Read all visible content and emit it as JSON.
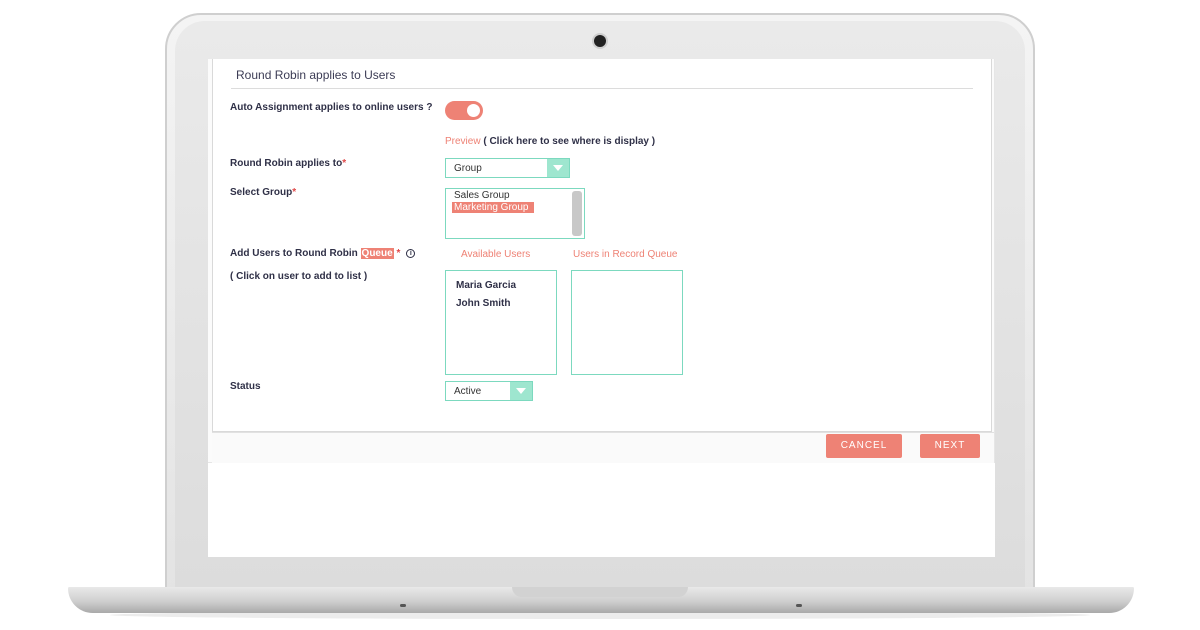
{
  "section": {
    "title": "Round Robin applies to Users"
  },
  "auto_assignment": {
    "label": "Auto Assignment applies to online users ?",
    "enabled": true
  },
  "preview": {
    "link": "Preview",
    "hint": " ( Click here to see where is display )"
  },
  "applies_to": {
    "label": "Round Robin applies to",
    "required": "*",
    "value": "Group"
  },
  "select_group": {
    "label": "Select Group",
    "required": "*",
    "options": [
      "Sales Group",
      "Marketing Group"
    ],
    "selected": "Marketing Group"
  },
  "add_users": {
    "label_prefix": "Add Users to Round Robin ",
    "label_highlight": "Queue",
    "required": " *",
    "info_icon": "i",
    "hint": "( Click on user to add to list )"
  },
  "available_users": {
    "title": "Available Users",
    "items": [
      "Maria Garcia",
      "John Smith"
    ]
  },
  "queue_users": {
    "title": "Users in Record Queue",
    "items": []
  },
  "status": {
    "label": "Status",
    "value": "Active"
  },
  "buttons": {
    "cancel": "CANCEL",
    "next": "NEXT"
  },
  "colors": {
    "accent": "#ee8275",
    "border": "#7cd9bf",
    "text": "#2f3047"
  }
}
